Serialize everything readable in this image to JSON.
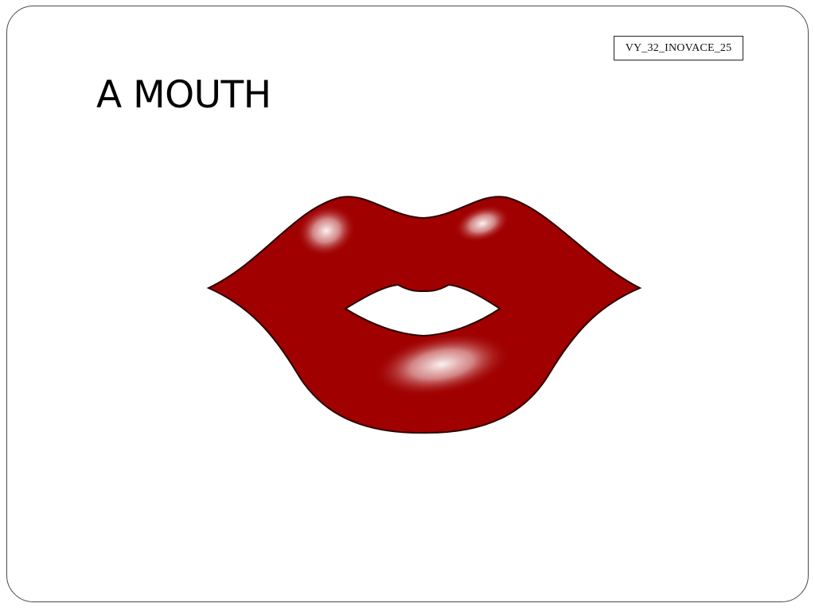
{
  "slide": {
    "code_label": "VY_32_INOVACE_25",
    "title": "A MOUTH",
    "illustration": {
      "name": "red-lips",
      "lip_color": "#A00000",
      "outline_color": "#2a0000",
      "highlight_color": "#ffffff"
    }
  }
}
